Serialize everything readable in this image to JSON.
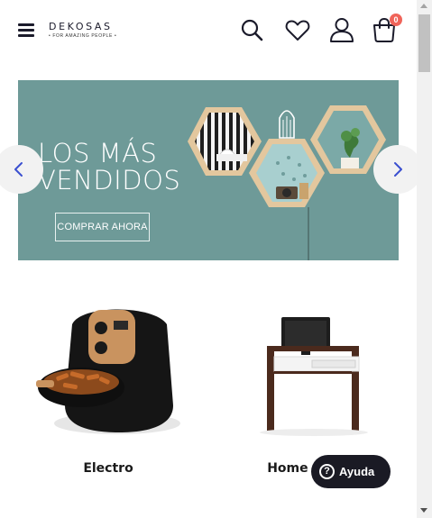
{
  "header": {
    "logo_main": "DEKOSAS",
    "logo_sub": "• FOR AMAZING PEOPLE •",
    "cart_count": "0",
    "icons": [
      "menu-icon",
      "search-icon",
      "heart-icon",
      "user-icon",
      "cart-icon"
    ]
  },
  "banner": {
    "title_line1": "LOS MÁS",
    "title_line2": "VENDIDOS",
    "cta_label": "COMPRAR AHORA",
    "background_color": "#6e9a98"
  },
  "slider": {
    "prev_icon": "chevron-left-icon",
    "next_icon": "chevron-right-icon",
    "arrow_color": "#3a4fd0"
  },
  "categories": [
    {
      "label": "Electro"
    },
    {
      "label": "Home Office"
    }
  ],
  "help": {
    "icon_glyph": "?",
    "label": "Ayuda"
  },
  "colors": {
    "badge": "#f0645a",
    "help_bg": "#1a1a24"
  }
}
